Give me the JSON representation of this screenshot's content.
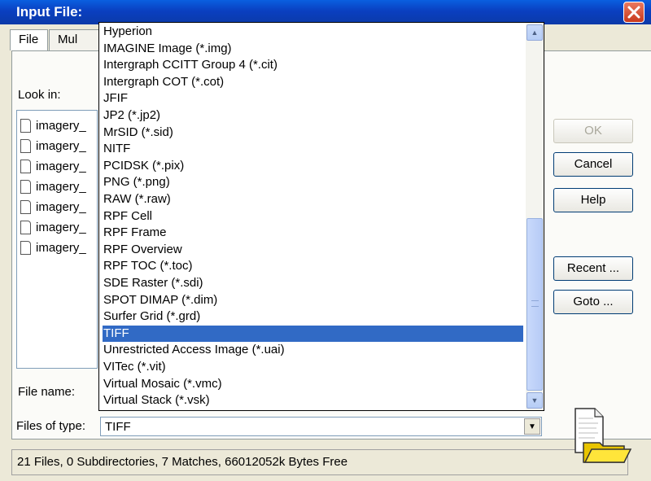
{
  "window": {
    "title": "Input File:",
    "close_icon": "close-icon"
  },
  "tabs": [
    {
      "label": "File"
    },
    {
      "label": "Mul"
    }
  ],
  "look_in_label": "Look in:",
  "file_list": [
    "imagery_",
    "imagery_",
    "imagery_",
    "imagery_",
    "imagery_",
    "imagery_",
    "imagery_"
  ],
  "buttons": {
    "ok": "OK",
    "cancel": "Cancel",
    "help": "Help",
    "recent": "Recent ...",
    "goto": "Goto ..."
  },
  "file_name_label": "File name:",
  "files_of_type": {
    "label": "Files of type:",
    "value": "TIFF"
  },
  "dropdown": {
    "options": [
      "Hyperion",
      "IMAGINE Image (*.img)",
      "Intergraph CCITT Group 4 (*.cit)",
      "Intergraph COT (*.cot)",
      "JFIF",
      "JP2 (*.jp2)",
      "MrSID (*.sid)",
      "NITF",
      "PCIDSK (*.pix)",
      "PNG (*.png)",
      "RAW (*.raw)",
      "RPF Cell",
      "RPF Frame",
      "RPF Overview",
      "RPF TOC (*.toc)",
      "SDE Raster (*.sdi)",
      "SPOT DIMAP (*.dim)",
      "Surfer Grid (*.grd)",
      "TIFF",
      "Unrestricted Access Image (*.uai)",
      "VITec (*.vit)",
      "Virtual Mosaic (*.vmc)",
      "Virtual Stack (*.vsk)"
    ],
    "selected": "TIFF"
  },
  "status": "21 Files, 0 Subdirectories, 7 Matches, 66012052k Bytes Free",
  "colors": {
    "titlebar": "#0a4fd4",
    "selection": "#316ac5",
    "dialog_bg": "#ece9d8"
  }
}
